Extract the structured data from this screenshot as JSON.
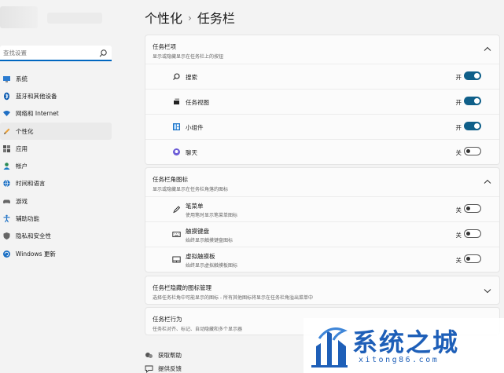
{
  "sidebar": {
    "search_placeholder": "查找设置",
    "items": [
      {
        "label": "系统",
        "icon": "monitor-icon"
      },
      {
        "label": "蓝牙和其他设备",
        "icon": "bluetooth-icon"
      },
      {
        "label": "网络和 Internet",
        "icon": "wifi-icon"
      },
      {
        "label": "个性化",
        "icon": "pencil-icon",
        "active": true
      },
      {
        "label": "应用",
        "icon": "apps-icon"
      },
      {
        "label": "帐户",
        "icon": "person-icon"
      },
      {
        "label": "时间和语言",
        "icon": "globe-icon"
      },
      {
        "label": "游戏",
        "icon": "gamepad-icon"
      },
      {
        "label": "辅助功能",
        "icon": "accessibility-icon"
      },
      {
        "label": "隐私和安全性",
        "icon": "shield-icon"
      },
      {
        "label": "Windows 更新",
        "icon": "update-icon"
      }
    ]
  },
  "breadcrumb": {
    "parent": "个性化",
    "separator": "›",
    "current": "任务栏"
  },
  "taskbar_items": {
    "title": "任务栏项",
    "subtitle": "显示或隐藏显示在任务栏上的按钮",
    "rows": [
      {
        "label": "搜索",
        "icon": "search-icon",
        "state": "开",
        "on": true
      },
      {
        "label": "任务视图",
        "icon": "task-view-icon",
        "state": "开",
        "on": true
      },
      {
        "label": "小组件",
        "icon": "widgets-icon",
        "state": "开",
        "on": true
      },
      {
        "label": "聊天",
        "icon": "chat-icon",
        "state": "关",
        "on": false
      }
    ]
  },
  "corner_icons": {
    "title": "任务栏角图标",
    "subtitle": "显示或隐藏显示在任务栏角落的图标",
    "rows": [
      {
        "label": "笔菜单",
        "sub": "使用笔时显示笔菜单图标",
        "icon": "pen-icon",
        "state": "关",
        "on": false
      },
      {
        "label": "触摸键盘",
        "sub": "始终显示触摸键盘图标",
        "icon": "keyboard-icon",
        "state": "关",
        "on": false
      },
      {
        "label": "虚拟触摸板",
        "sub": "始终显示虚拟触摸板图标",
        "icon": "touchpad-icon",
        "state": "关",
        "on": false
      }
    ]
  },
  "overflow": {
    "title": "任务栏隐藏的图标管理",
    "subtitle": "选择任务栏角中可能显示的图标 - 所有其他图标将显示在任务栏角溢出菜单中"
  },
  "behaviors": {
    "title": "任务栏行为",
    "subtitle": "任务栏对齐、标记、自动隐藏和多个显示器"
  },
  "footer": {
    "help": "获取帮助",
    "feedback": "提供反馈"
  },
  "watermark": {
    "title": "系统之城",
    "sub": "xitong86.com"
  },
  "colors": {
    "accent": "#0f5f89",
    "brand": "#1e5fb8"
  }
}
